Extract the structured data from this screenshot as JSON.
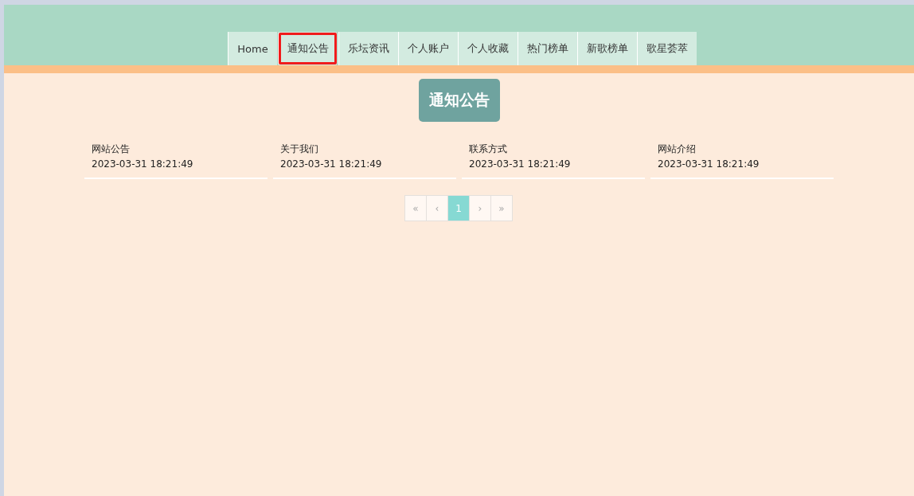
{
  "nav": {
    "items": [
      {
        "label": "Home",
        "selected": false
      },
      {
        "label": "通知公告",
        "selected": true
      },
      {
        "label": "乐坛资讯",
        "selected": false
      },
      {
        "label": "个人账户",
        "selected": false
      },
      {
        "label": "个人收藏",
        "selected": false
      },
      {
        "label": "热门榜单",
        "selected": false
      },
      {
        "label": "新歌榜单",
        "selected": false
      },
      {
        "label": "歌星荟萃",
        "selected": false
      }
    ]
  },
  "page_title": "通知公告",
  "notices": [
    {
      "title": "网站公告",
      "time": "2023-03-31 18:21:49"
    },
    {
      "title": "关于我们",
      "time": "2023-03-31 18:21:49"
    },
    {
      "title": "联系方式",
      "time": "2023-03-31 18:21:49"
    },
    {
      "title": "网站介绍",
      "time": "2023-03-31 18:21:49"
    }
  ],
  "pagination": [
    {
      "label": "«",
      "selected": false
    },
    {
      "label": "‹",
      "selected": false
    },
    {
      "label": "1",
      "selected": true
    },
    {
      "label": "›",
      "selected": false
    },
    {
      "label": "»",
      "selected": false
    }
  ]
}
